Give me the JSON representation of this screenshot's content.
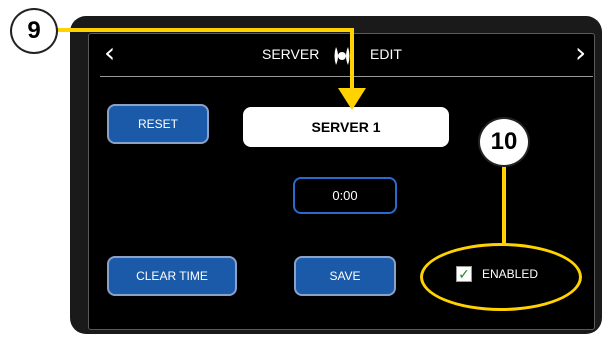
{
  "header": {
    "title_left": "SERVER",
    "title_right": "EDIT",
    "prev_glyph": "‹",
    "next_glyph": "›"
  },
  "buttons": {
    "reset": "RESET",
    "clear_time": "CLEAR TIME",
    "save": "SAVE"
  },
  "server_name": {
    "value": "SERVER 1"
  },
  "timer": {
    "value": "0:00"
  },
  "enabled_checkbox": {
    "label": "ENABLED",
    "checked": true,
    "check_glyph": "✓"
  },
  "callouts": [
    {
      "number": "9"
    },
    {
      "number": "10"
    }
  ],
  "colors": {
    "accent_blue": "#1a5aa8",
    "highlight_yellow": "#ffd200",
    "device_bg": "#1a1a1a"
  },
  "icons": [
    "chevron-left-icon",
    "chevron-right-icon",
    "logo-icon",
    "checkmark-icon"
  ]
}
